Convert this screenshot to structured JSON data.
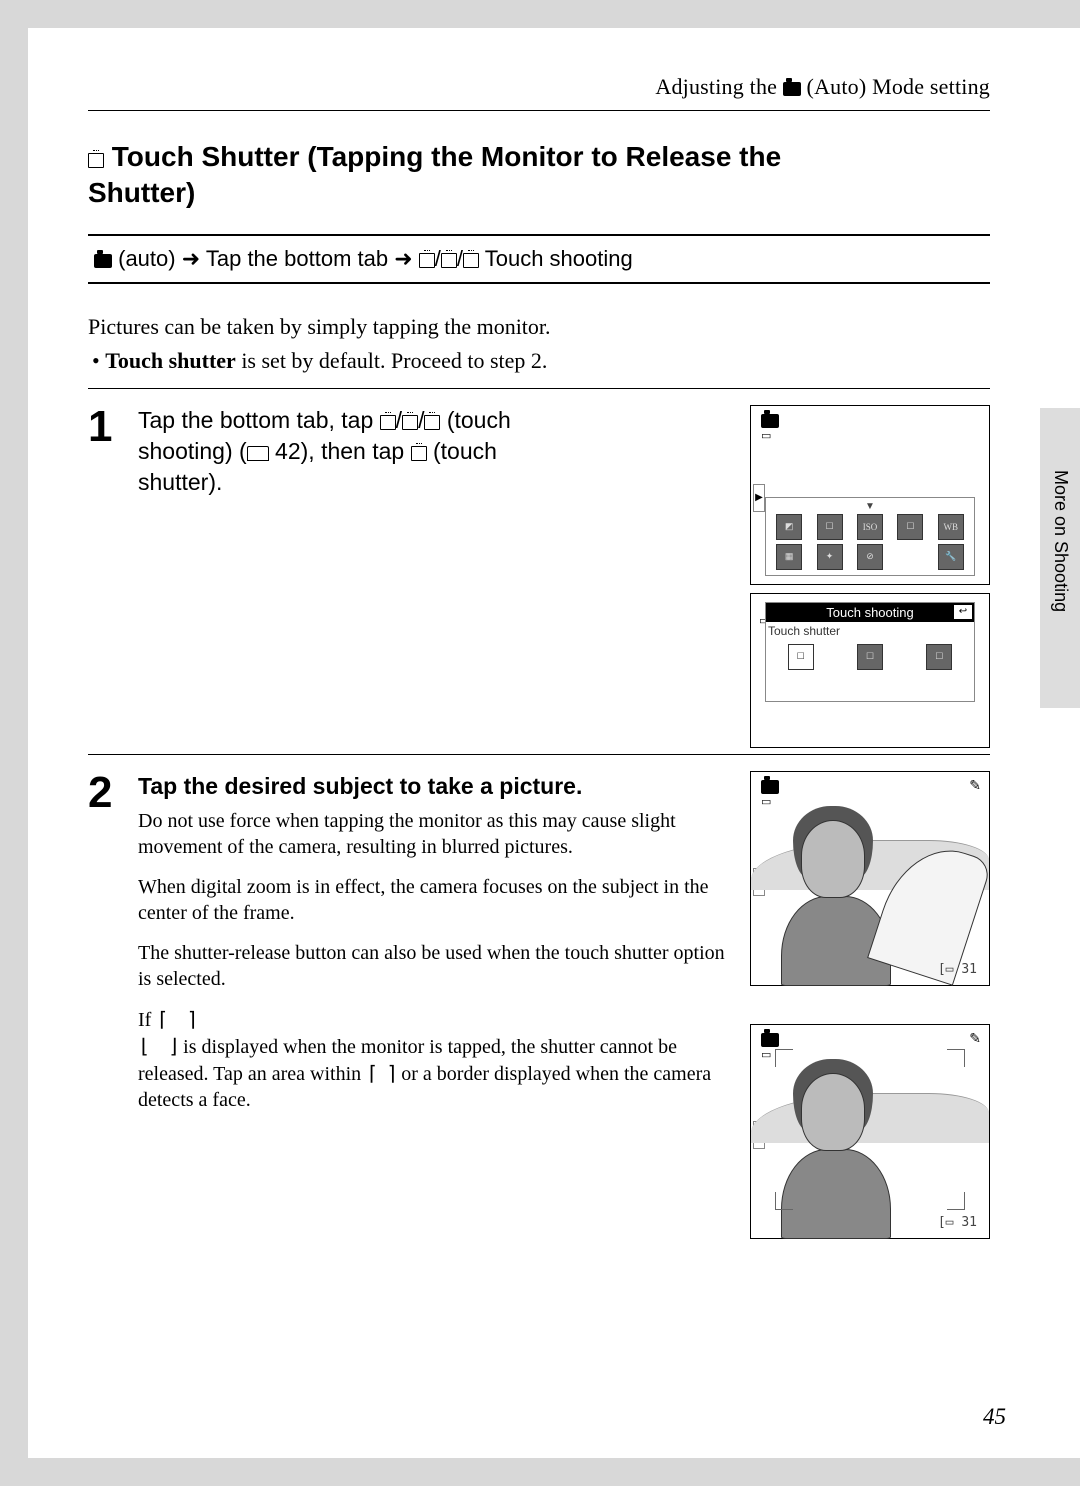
{
  "header": {
    "prefix": "Adjusting the ",
    "suffix": " (Auto) Mode setting"
  },
  "heading": {
    "line1": " Touch Shutter (Tapping the Monitor to Release the",
    "line2": "Shutter)"
  },
  "navbox": {
    "mode": " (auto) ",
    "step2": " Tap the bottom tab ",
    "suffix": " Touch shooting"
  },
  "intro": "Pictures can be taken by simply tapping the monitor.",
  "bullet_prefix": "Touch shutter",
  "bullet_rest": " is set by default. Proceed to step 2.",
  "step1": {
    "num": "1",
    "t1": "Tap the bottom tab, tap ",
    "t2": " (touch",
    "t3": "shooting) (",
    "pageref": " 42), then tap ",
    "t4": " (touch",
    "t5": "shutter)."
  },
  "step2": {
    "num": "2",
    "title": "Tap the desired subject to take a picture.",
    "p1": "Do not use force when tapping the monitor as this may cause slight movement of the camera, resulting in blurred pictures.",
    "p2": "When digital zoom is in effect, the camera focuses on the subject in the center of the frame.",
    "p3": "The shutter-release button can also be used when the touch shutter option is selected.",
    "p4a": "If ",
    "p4b": " is displayed when the monitor is tapped, the shutter cannot be released. Tap an area within ",
    "p4c": " or a border displayed when the camera detects a face."
  },
  "labels": {
    "touch_shooting": "Touch shooting",
    "touch_shutter": "Touch shutter",
    "iso": "ISO",
    "wb": "WB",
    "count": "31"
  },
  "sidebar": "More on Shooting",
  "page_number": "45"
}
